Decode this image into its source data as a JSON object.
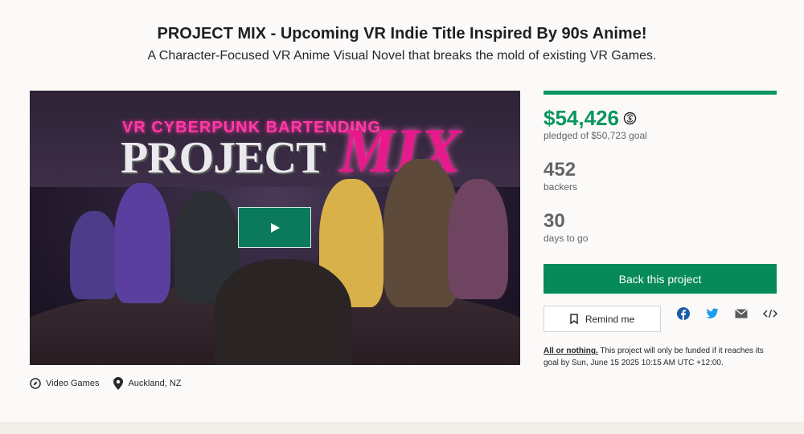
{
  "project": {
    "title": "PROJECT MIX - Upcoming VR Indie Title Inspired By 90s Anime!",
    "subtitle": "A Character-Focused VR Anime Visual Novel that breaks the mold of existing VR Games."
  },
  "video": {
    "tagline": "VR CYBERPUNK BARTENDING",
    "logo_part1": "PROJECT",
    "logo_part2": "MIX",
    "play_icon": "play-icon"
  },
  "meta": {
    "category": "Video Games",
    "category_icon": "compass-icon",
    "location": "Auckland, NZ",
    "location_icon": "location-pin-icon"
  },
  "stats": {
    "pledged": "$54,426",
    "pledged_label": "pledged of $50,723 goal",
    "backers": "452",
    "backers_label": "backers",
    "days": "30",
    "days_label": "days to go",
    "funding_progress": 1.0
  },
  "actions": {
    "back_label": "Back this project",
    "remind_label": "Remind me"
  },
  "fine_print": {
    "link": "All or nothing.",
    "text": " This project will only be funded if it reaches its goal by Sun, June 15 2025 10:15 AM UTC +12:00."
  },
  "colors": {
    "accent": "#0b9563",
    "button": "#068a5a",
    "twitter": "#1d9bf0",
    "facebook": "#1877f2"
  }
}
